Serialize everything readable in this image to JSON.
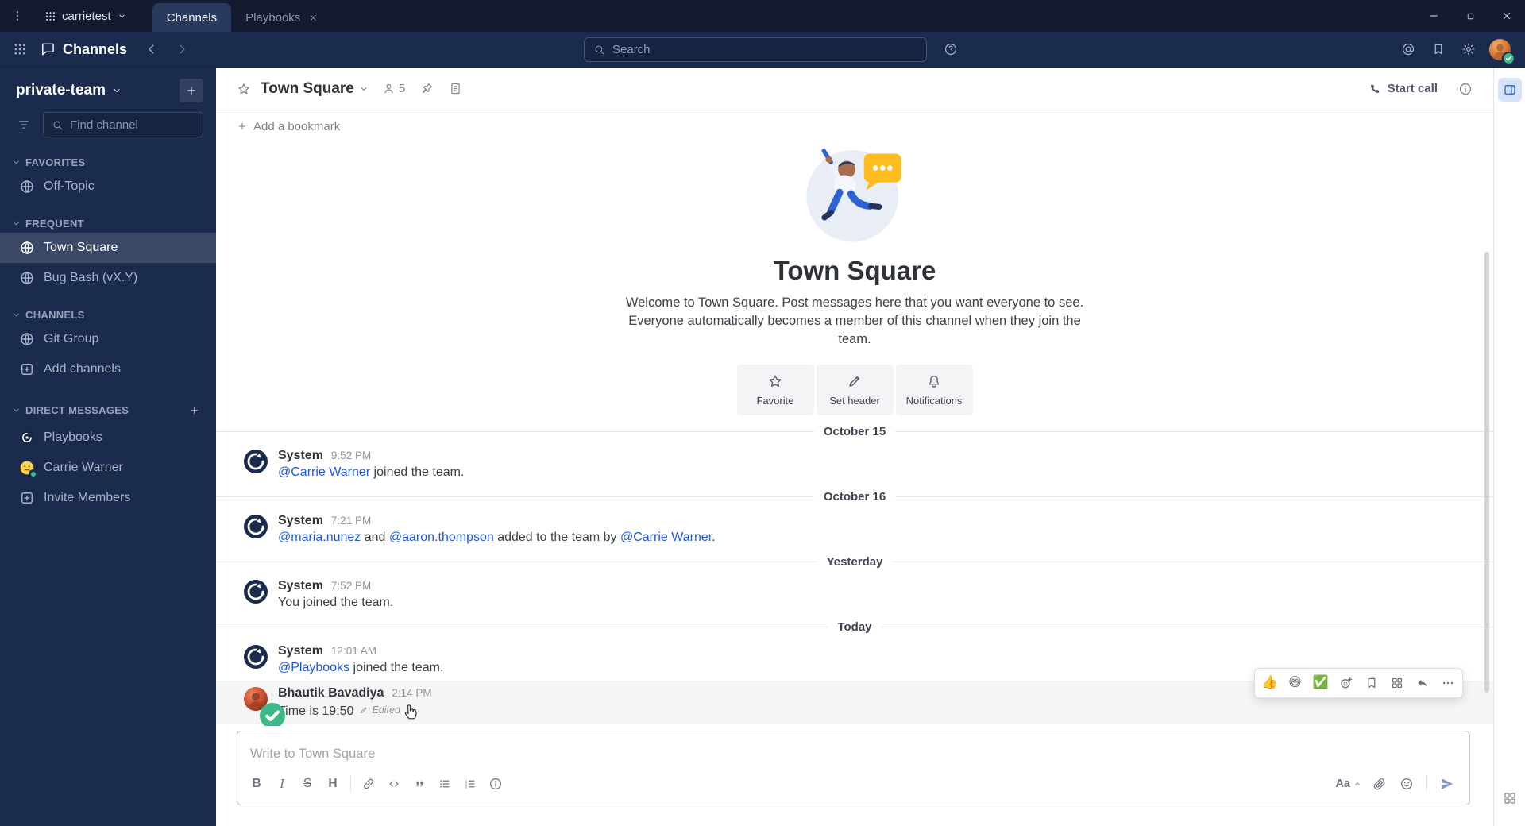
{
  "titlebar": {
    "server_name": "carrietest",
    "tabs": [
      {
        "label": "Channels",
        "active": true,
        "closable": false
      },
      {
        "label": "Playbooks",
        "active": false,
        "closable": true
      }
    ]
  },
  "global_header": {
    "product": "Channels",
    "search_placeholder": "Search"
  },
  "sidebar": {
    "team": "private-team",
    "find_placeholder": "Find channel",
    "sections": [
      {
        "title": "FAVORITES",
        "add": false,
        "items": [
          {
            "label": "Off-Topic",
            "icon": "globe"
          }
        ]
      },
      {
        "title": "FREQUENT",
        "add": false,
        "items": [
          {
            "label": "Town Square",
            "icon": "globe",
            "active": true
          },
          {
            "label": "Bug Bash (vX.Y)",
            "icon": "globe"
          }
        ]
      },
      {
        "title": "CHANNELS",
        "add": false,
        "items": [
          {
            "label": "Git Group",
            "icon": "globe"
          },
          {
            "label": "Add channels",
            "icon": "plus-box"
          }
        ]
      },
      {
        "title": "DIRECT MESSAGES",
        "add": true,
        "items": [
          {
            "label": "Playbooks",
            "icon": "playbooks"
          },
          {
            "label": "Carrie Warner",
            "icon": "avatar-yellow",
            "status": "online"
          },
          {
            "label": "Invite Members",
            "icon": "plus-box"
          }
        ]
      }
    ]
  },
  "channel": {
    "name": "Town Square",
    "member_count": "5",
    "start_call": "Start call",
    "add_bookmark": "Add a bookmark"
  },
  "intro": {
    "title": "Town Square",
    "description": "Welcome to Town Square. Post messages here that you want everyone to see. Everyone automatically becomes a member of this channel when they join the team.",
    "actions": [
      {
        "label": "Favorite",
        "icon": "star"
      },
      {
        "label": "Set header",
        "icon": "pencil"
      },
      {
        "label": "Notifications",
        "icon": "bell"
      }
    ]
  },
  "messages": [
    {
      "type": "divider",
      "label": "October 15"
    },
    {
      "type": "post",
      "avatar": "system",
      "sender": "System",
      "time": "9:52 PM",
      "parts": [
        {
          "text": "@Carrie Warner",
          "link": true
        },
        {
          "text": " joined the team."
        }
      ]
    },
    {
      "type": "divider",
      "label": "October 16"
    },
    {
      "type": "post",
      "avatar": "system",
      "sender": "System",
      "time": "7:21 PM",
      "parts": [
        {
          "text": "@maria.nunez",
          "link": true
        },
        {
          "text": " and "
        },
        {
          "text": "@aaron.thompson",
          "link": true
        },
        {
          "text": " added to the team by "
        },
        {
          "text": "@Carrie Warner",
          "link": true
        },
        {
          "text": "."
        }
      ]
    },
    {
      "type": "divider",
      "label": "Yesterday"
    },
    {
      "type": "post",
      "avatar": "system",
      "sender": "System",
      "time": "7:52 PM",
      "parts": [
        {
          "text": "You joined the team."
        }
      ]
    },
    {
      "type": "divider",
      "label": "Today"
    },
    {
      "type": "post",
      "avatar": "system",
      "sender": "System",
      "time": "12:01 AM",
      "parts": [
        {
          "text": "@Playbooks",
          "link": true
        },
        {
          "text": " joined the team."
        }
      ]
    },
    {
      "type": "post",
      "avatar": "user-red",
      "sender": "Bhautik Bavadiya",
      "time": "2:14 PM",
      "parts": [
        {
          "text": "Time is 19:50"
        }
      ],
      "edited": "Edited",
      "hovered": true,
      "cursor": true
    }
  ],
  "hover_toolbar": {
    "reactions": [
      {
        "emoji": "👍",
        "name": "thumbsup"
      },
      {
        "emoji": "😄",
        "name": "smile"
      },
      {
        "emoji": "✅",
        "name": "white-check-mark"
      }
    ],
    "actions": [
      {
        "icon": "emoji-plus",
        "name": "add-reaction"
      },
      {
        "icon": "bookmark",
        "name": "save-message"
      },
      {
        "icon": "apps",
        "name": "message-actions"
      },
      {
        "icon": "reply",
        "name": "reply"
      },
      {
        "icon": "dots-h",
        "name": "more-actions"
      }
    ]
  },
  "composer": {
    "placeholder": "Write to Town Square",
    "format_labels": {
      "bold": "B",
      "italic": "I",
      "strike": "S",
      "heading": "H",
      "preview": "Aa"
    }
  }
}
